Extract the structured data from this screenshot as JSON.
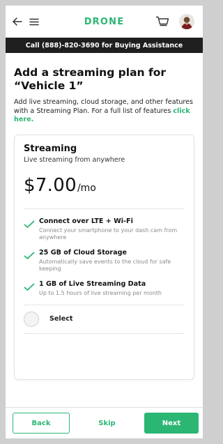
{
  "header": {
    "brand": "DRONE",
    "icons": [
      "back-arrow-icon",
      "menu-icon",
      "cart-icon",
      "avatar"
    ]
  },
  "banner": {
    "text": "Call (888)-820-3690 for Buying Assistance"
  },
  "main": {
    "title": "Add a streaming plan for “Vehicle 1”",
    "intro_text": "Add live streaming, cloud storage, and other features with a Streaming Plan. For a full list of features ",
    "intro_link": "click here."
  },
  "plan": {
    "name": "Streaming",
    "subtitle": "Live streaming from anywhere",
    "price": "$7.00",
    "period": "/mo",
    "features": [
      {
        "title": "Connect over LTE + Wi-Fi",
        "description": "Connect your smartphone to your dash cam from anywhere"
      },
      {
        "title": "25 GB of Cloud Storage",
        "description": "Automatically save events to the cloud for safe keeping"
      },
      {
        "title": "1 GB of Live Streaming Data",
        "description": "Up to 1.5 hours of live streaming per month"
      }
    ],
    "select_label": "Select",
    "selected": false
  },
  "footer": {
    "back_label": "Back",
    "skip_label": "Skip",
    "next_label": "Next"
  },
  "colors": {
    "accent": "#2bb673",
    "banner_bg": "#1f1f1f"
  }
}
